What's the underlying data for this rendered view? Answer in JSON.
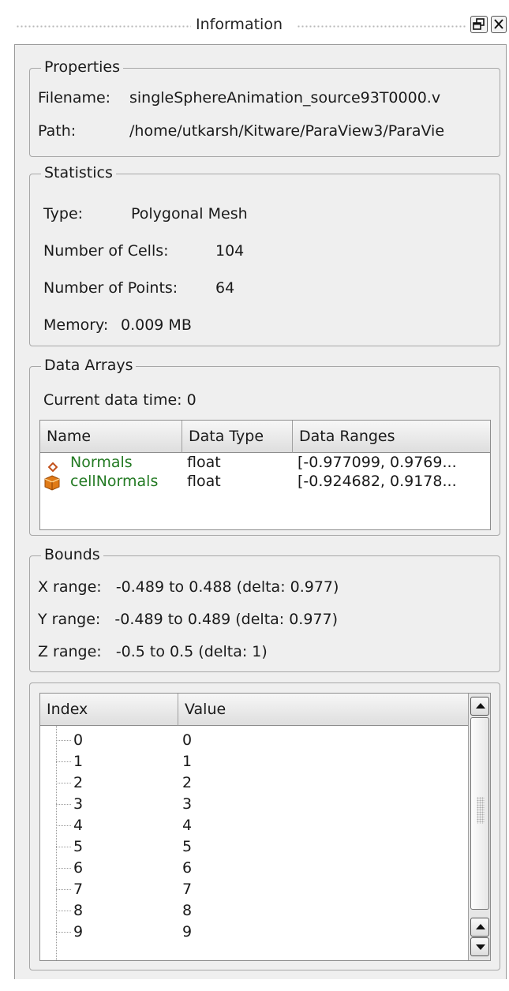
{
  "window": {
    "title": "Information"
  },
  "properties": {
    "title": "Properties",
    "filename_label": "Filename:",
    "filename_value": "singleSphereAnimation_source93T0000.v",
    "path_label": "Path:",
    "path_value": "/home/utkarsh/Kitware/ParaView3/ParaVie"
  },
  "statistics": {
    "title": "Statistics",
    "type_label": "Type:",
    "type_value": "Polygonal Mesh",
    "cells_label": "Number of Cells:",
    "cells_value": "104",
    "points_label": "Number of Points:",
    "points_value": "64",
    "memory_label": "Memory:",
    "memory_value": "0.009 MB"
  },
  "data_arrays": {
    "title": "Data Arrays",
    "current_time": "Current data time: 0",
    "columns": [
      "Name",
      "Data Type",
      "Data Ranges"
    ],
    "rows": [
      {
        "icon": "point-data-icon",
        "name": "Normals",
        "type": "float",
        "range": "[-0.977099, 0.9769..."
      },
      {
        "icon": "cell-data-icon",
        "name": "cellNormals",
        "type": "float",
        "range": "[-0.924682, 0.9178..."
      }
    ]
  },
  "bounds": {
    "title": "Bounds",
    "x": "X range:   -0.489 to 0.488 (delta: 0.977)",
    "y": "Y range:   -0.489 to 0.489 (delta: 0.977)",
    "z": "Z range:   -0.5 to 0.5 (delta: 1)"
  },
  "index_table": {
    "columns": [
      "Index",
      "Value"
    ],
    "rows": [
      {
        "index": "0",
        "value": "0"
      },
      {
        "index": "1",
        "value": "1"
      },
      {
        "index": "2",
        "value": "2"
      },
      {
        "index": "3",
        "value": "3"
      },
      {
        "index": "4",
        "value": "4"
      },
      {
        "index": "5",
        "value": "5"
      },
      {
        "index": "6",
        "value": "6"
      },
      {
        "index": "7",
        "value": "7"
      },
      {
        "index": "8",
        "value": "8"
      },
      {
        "index": "9",
        "value": "9"
      }
    ]
  }
}
